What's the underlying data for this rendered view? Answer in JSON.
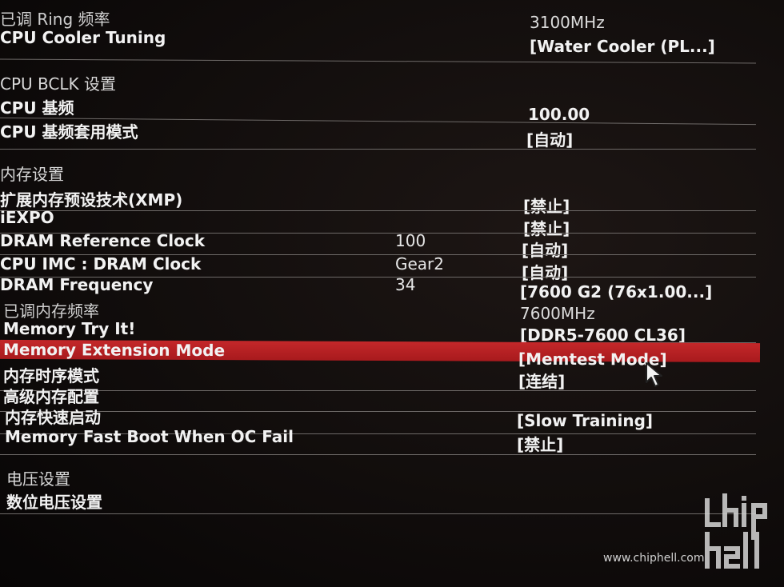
{
  "rows": [
    {
      "label": "已调 Ring 频率",
      "value": "3100MHz"
    },
    {
      "label": "CPU Cooler Tuning",
      "value": "[Water Cooler (PL...]"
    },
    {
      "label": "CPU  BCLK  设置"
    },
    {
      "label": "CPU 基频",
      "value": "100.00"
    },
    {
      "label": "CPU 基频套用模式",
      "value": "[自动]"
    },
    {
      "label": "内存设置"
    },
    {
      "label": "扩展内存预设技术(XMP)",
      "value": "[禁止]"
    },
    {
      "label": "iEXPO",
      "value": "[禁止]"
    },
    {
      "label": "DRAM Reference Clock",
      "mid": "100",
      "value": "[自动]"
    },
    {
      "label": "CPU IMC : DRAM Clock",
      "mid": "Gear2",
      "value": "[自动]"
    },
    {
      "label": "DRAM Frequency",
      "mid": "34",
      "value": "[7600 G2 (76x1.00...]"
    },
    {
      "label": "已调内存频率",
      "value": "7600MHz"
    },
    {
      "label": "Memory Try It!",
      "value": "[DDR5-7600 CL36]"
    },
    {
      "label": "Memory Extension Mode",
      "value": "[Memtest Mode]"
    },
    {
      "label": "内存时序模式",
      "value": "[连结]"
    },
    {
      "label": "高级内存配置"
    },
    {
      "label": "内存快速启动",
      "value": "[Slow Training]"
    },
    {
      "label": "Memory Fast Boot When OC Fail",
      "value": "[禁止]"
    },
    {
      "label": "电压设置"
    },
    {
      "label": "数位电压设置"
    }
  ],
  "watermark": {
    "logo_text": "chip hell",
    "url": "www.chiphell.com"
  },
  "colors": {
    "selected_row": "#b82023",
    "text": "#f2f2f2",
    "divider": "#6e6a68"
  },
  "icons": {
    "cursor": "mouse-pointer-icon"
  }
}
